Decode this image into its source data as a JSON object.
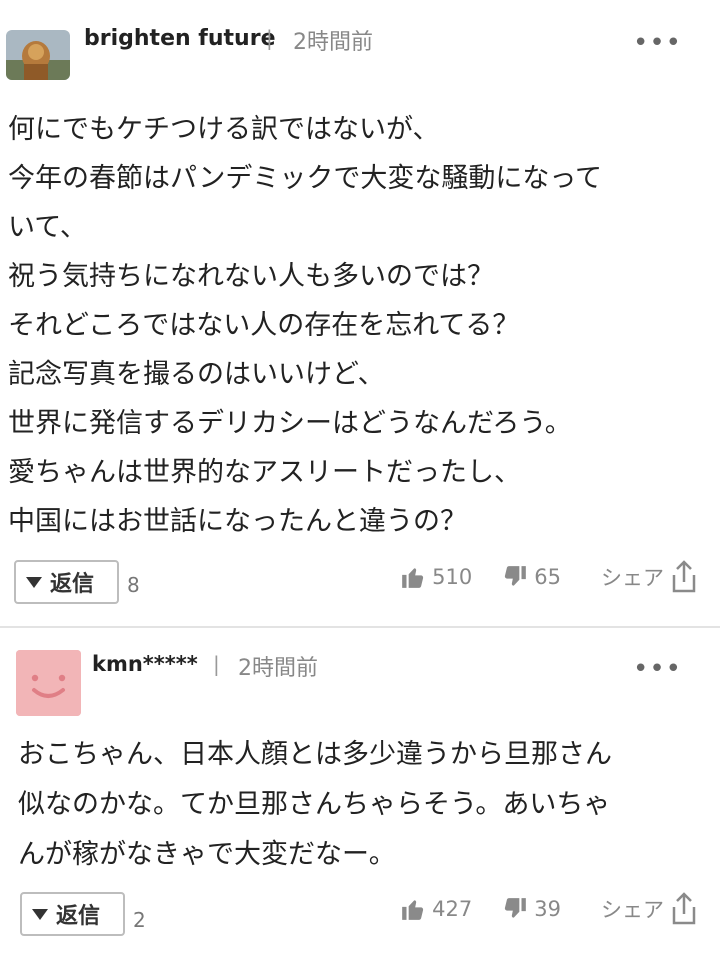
{
  "comments": [
    {
      "user": "brighten future",
      "separator": "|",
      "time": "2時間前",
      "more": "•••",
      "body": "何にでもケチつける訳ではないが、\n今年の春節はパンデミックで大変な騒動になって\nいて、\n祝う気持ちになれない人も多いのでは？\nそれどころではない人の存在を忘れてる？\n記念写真を撮るのはいいけど、\n世界に発信するデリカシーはどうなんだろう。\n愛ちゃんは世界的なアスリートだったし、\n中国にはお世話になったんと違うの？",
      "reply_label": "返信",
      "reply_count": "8",
      "likes": "510",
      "dislikes": "65",
      "share_label": "シェア"
    },
    {
      "user": "kmn*****",
      "separator": "|",
      "time": "2時間前",
      "more": "•••",
      "body": "おこちゃん、日本人顔とは多少違うから旦那さん\n似なのかな。てか旦那さんちゃらそう。あいちゃ\nんが稼がなきゃで大変だなー。",
      "reply_label": "返信",
      "reply_count": "2",
      "likes": "427",
      "dislikes": "39",
      "share_label": "シェア"
    }
  ],
  "colors": {
    "avatar_placeholder": "#f2b5b7",
    "avatar_face": "#e07f86",
    "icon_gray": "#8a8a8a"
  },
  "icons": [
    "photo-avatar",
    "smiley-avatar",
    "more-icon",
    "caret-down-icon",
    "thumbs-up-icon",
    "thumbs-down-icon",
    "share-icon"
  ]
}
